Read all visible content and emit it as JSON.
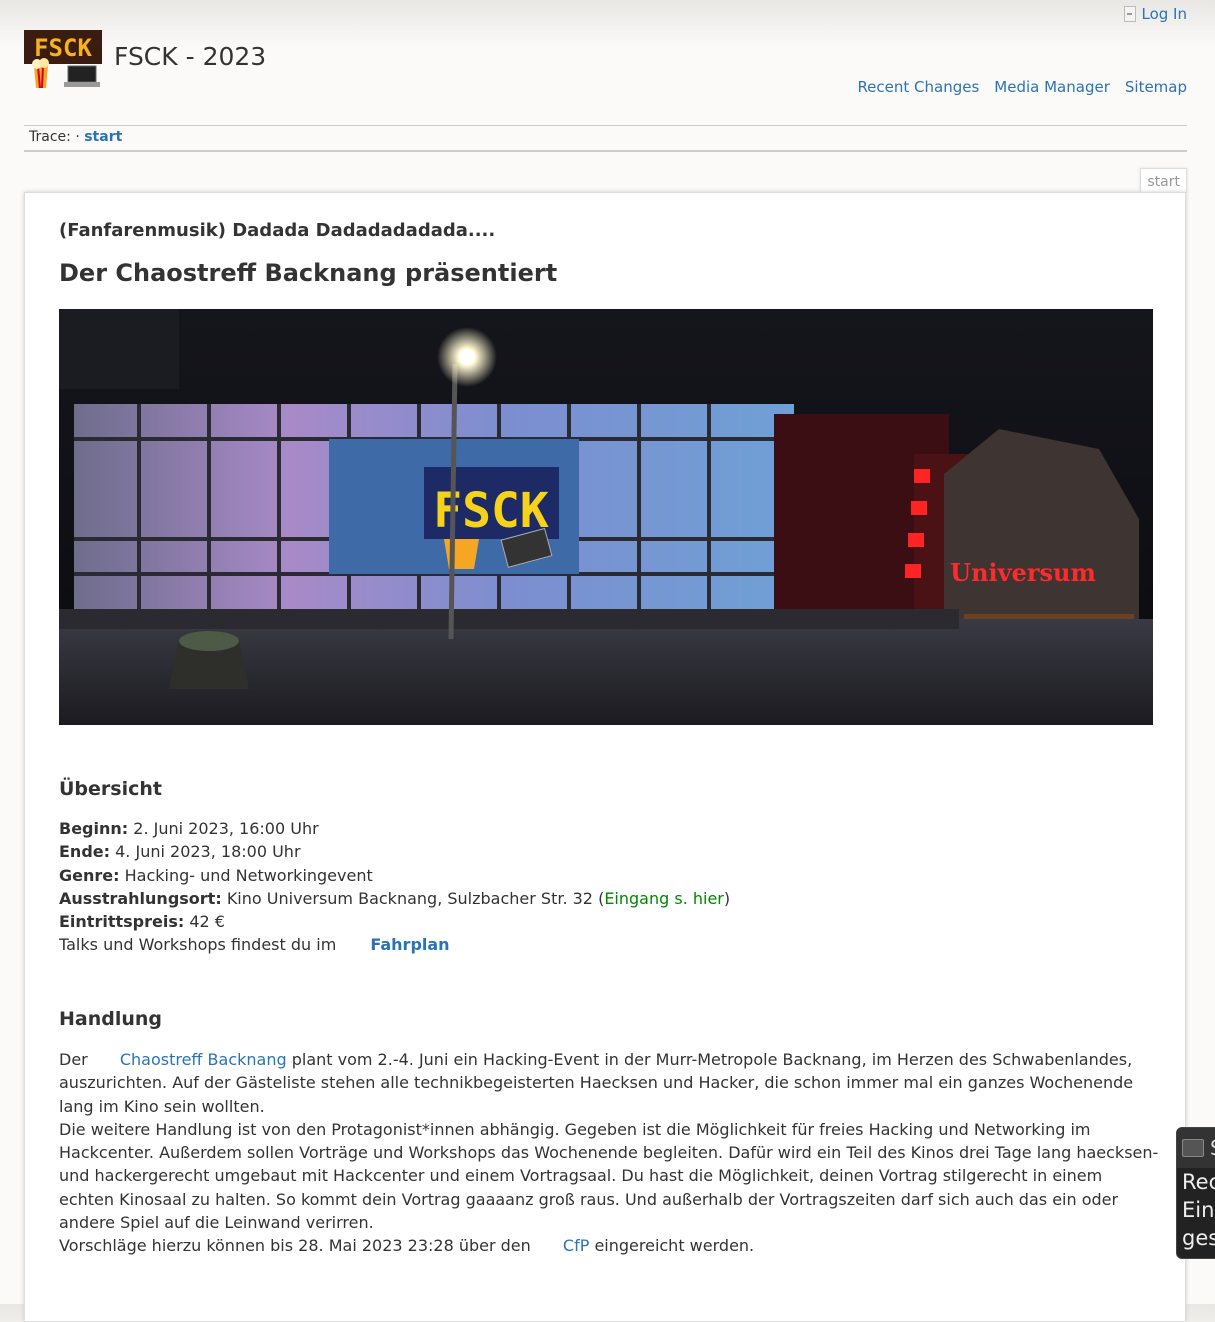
{
  "header": {
    "login_label": "Log In",
    "site_title": "FSCK - 2023",
    "logo_text": "FSCK",
    "nav": [
      "Recent Changes",
      "Media Manager",
      "Sitemap"
    ]
  },
  "trace": {
    "label": "Trace:",
    "sep": "·",
    "link": "start"
  },
  "page_tab": "start",
  "content": {
    "subtitle": "(Fanfarenmusik) Dadada Dadadadadada....",
    "headline": "Der Chaostreff Backnang präsentiert",
    "hero": {
      "sign_text": "FSCK",
      "building_sign": "Universum"
    },
    "overview_heading": "Übersicht",
    "overview": {
      "begin_label": "Beginn:",
      "begin_value": "2. Juni 2023, 16:00 Uhr",
      "end_label": "Ende:",
      "end_value": "4. Juni 2023, 18:00 Uhr",
      "genre_label": "Genre:",
      "genre_value": "Hacking- und Networkingevent",
      "venue_label": "Ausstrahlungsort:",
      "venue_value": "Kino Universum Backnang, Sulzbacher Str. 32 (",
      "venue_link": "Eingang s. hier",
      "venue_close": ")",
      "price_label": "Eintrittspreis:",
      "price_value": "42 €",
      "talks_text": "Talks und Workshops findest du im",
      "talks_link": "Fahrplan"
    },
    "story_heading": "Handlung",
    "story": {
      "p1_pre": "Der",
      "p1_link": "Chaostreff Backnang",
      "p1_post": "plant vom 2.-4. Juni ein Hacking-Event in der Murr-Metropole Backnang, im Herzen des Schwabenlandes, auszurichten. Auf der Gästeliste stehen alle technikbegeisterten Haecksen und Hacker, die schon immer mal ein ganzes Wochenende lang im Kino sein wollten.",
      "p2": "Die weitere Handlung ist von den Protagonist*innen abhängig. Gegeben ist die Möglichkeit für freies Hacking und Networking im Hackcenter. Außerdem sollen Vorträge und Workshops das Wochenende begleiten. Dafür wird ein Teil des Kinos drei Tage lang haecksen- und hackergerecht umgebaut mit Hackcenter und einem Vortragsaal. Du hast die Möglichkeit, deinen Vortrag stilgerecht in einem echten Kinosaal zu halten. So kommt dein Vortrag gaaaanz groß raus. Und außerhalb der Vortragszeiten darf sich auch das ein oder andere Spiel auf die Leinwand verirren.",
      "p3_pre": "Vorschläge hierzu können bis 28. Mai 2023 23:28 über den",
      "p3_link": "CfP",
      "p3_post": "eingereicht werden."
    }
  },
  "widget": {
    "title": "S",
    "line1": "Rec",
    "line2": "Ein",
    "line3": "ges"
  }
}
